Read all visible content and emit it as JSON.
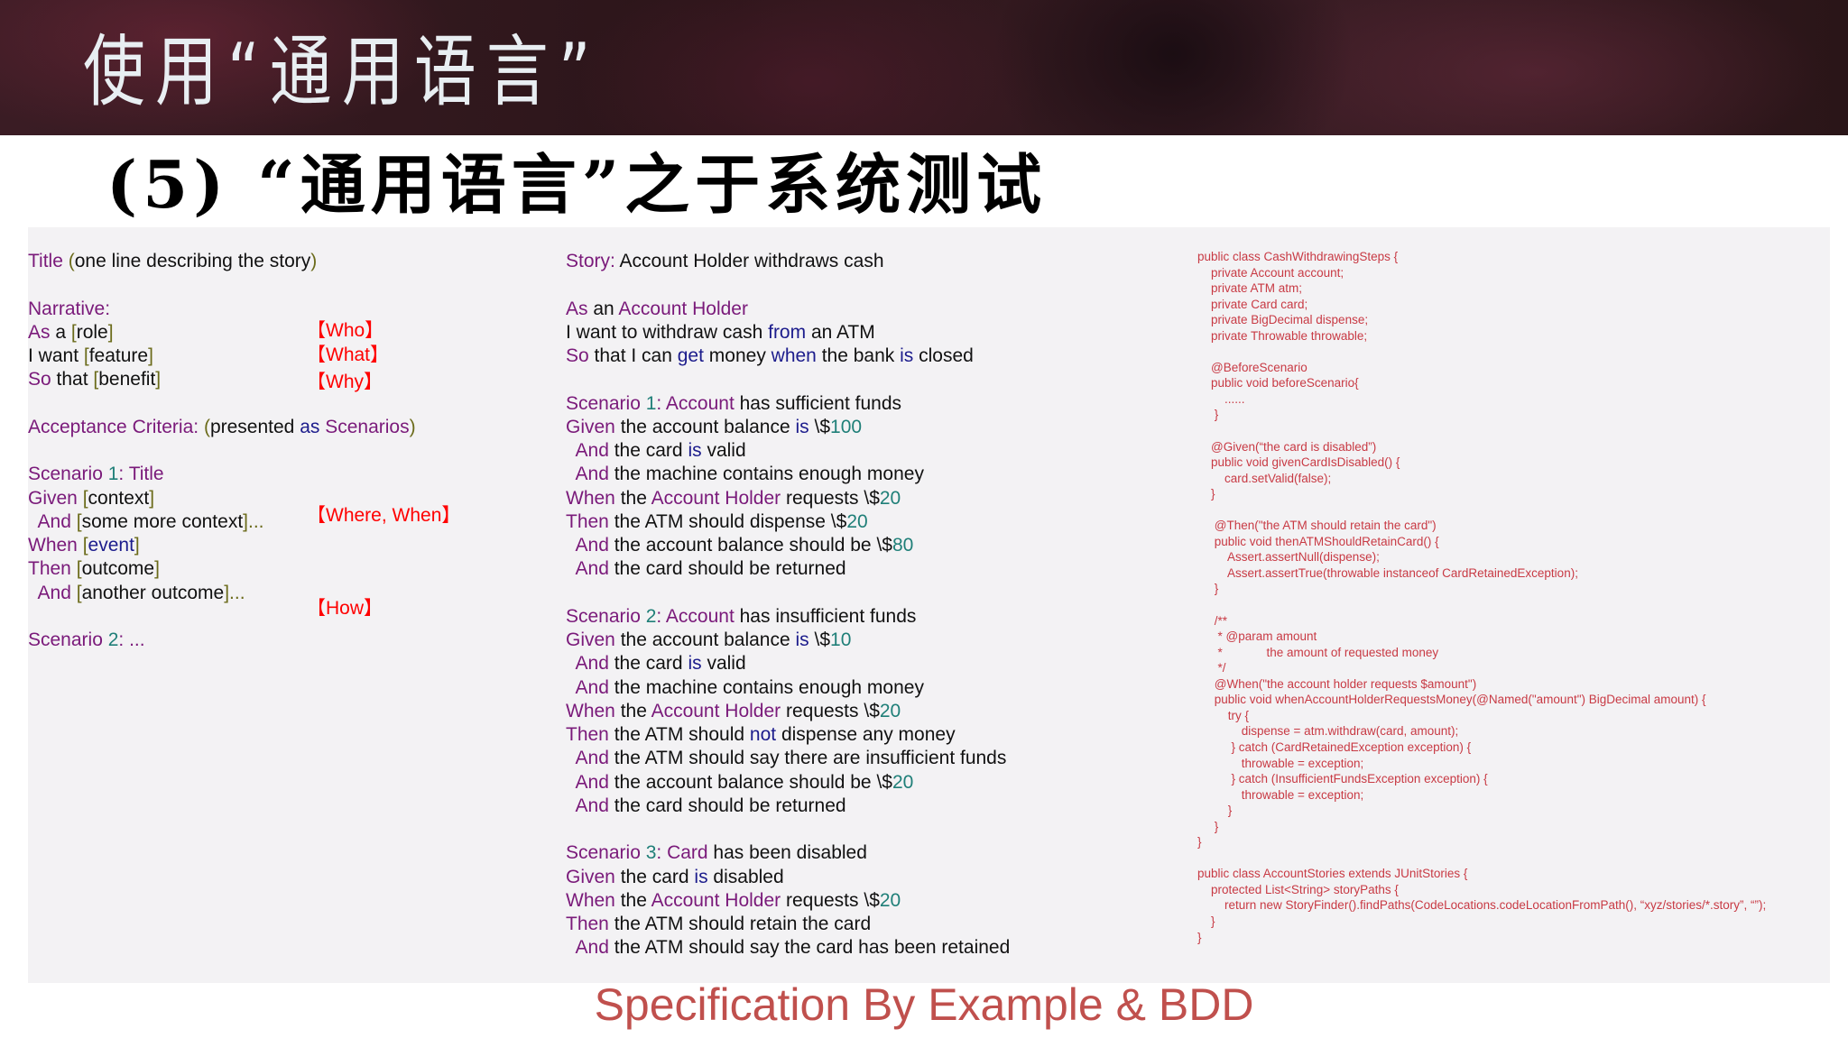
{
  "header": {
    "title": "使用“通用语言”"
  },
  "subtitle": "(5) “通用语言”之于系统测试",
  "colors": {
    "keyword": "#7a1a7a",
    "bracket": "#6b6b1a",
    "number": "#1f7f78",
    "verb": "#1c1c8c",
    "tag": "#ff0000",
    "code": "#c83a44",
    "footer": "#c0504d"
  },
  "template": [
    [
      [
        "Title",
        "k"
      ],
      [
        " ",
        ""
      ],
      [
        "(",
        "b"
      ],
      [
        "one line describing the story",
        ""
      ],
      [
        ")",
        "b"
      ]
    ],
    [],
    [
      [
        "Narrative:",
        "k"
      ]
    ],
    [
      [
        "As",
        "k"
      ],
      [
        " a ",
        ""
      ],
      [
        "[",
        "b"
      ],
      [
        "role",
        ""
      ],
      [
        "]",
        "b"
      ]
    ],
    [
      [
        "I want ",
        ""
      ],
      [
        "[",
        "b"
      ],
      [
        "feature",
        ""
      ],
      [
        "]",
        "b"
      ]
    ],
    [
      [
        "So",
        "k"
      ],
      [
        " that ",
        ""
      ],
      [
        "[",
        "b"
      ],
      [
        "benefit",
        ""
      ],
      [
        "]",
        "b"
      ]
    ],
    [],
    [
      [
        "Acceptance Criteria:",
        "k"
      ],
      [
        " ",
        ""
      ],
      [
        "(",
        "b"
      ],
      [
        "presented ",
        ""
      ],
      [
        "as",
        "v"
      ],
      [
        " Scenarios",
        "k"
      ],
      [
        ")",
        "b"
      ]
    ],
    [],
    [
      [
        "Scenario ",
        "k"
      ],
      [
        "1",
        "n"
      ],
      [
        ": Title",
        "k"
      ]
    ],
    [
      [
        "Given",
        "k"
      ],
      [
        " ",
        ""
      ],
      [
        "[",
        "b"
      ],
      [
        "context",
        ""
      ],
      [
        "]",
        "b"
      ]
    ],
    [
      [
        "  And",
        "k"
      ],
      [
        " ",
        ""
      ],
      [
        "[",
        "b"
      ],
      [
        "some more context",
        ""
      ],
      [
        "]...",
        "b"
      ]
    ],
    [
      [
        "When",
        "k"
      ],
      [
        " ",
        ""
      ],
      [
        "[",
        "b"
      ],
      [
        "event",
        "v"
      ],
      [
        "]",
        "b"
      ]
    ],
    [
      [
        "Then",
        "k"
      ],
      [
        " ",
        ""
      ],
      [
        "[",
        "b"
      ],
      [
        "outcome",
        ""
      ],
      [
        "]",
        "b"
      ]
    ],
    [
      [
        "  And",
        "k"
      ],
      [
        " ",
        ""
      ],
      [
        "[",
        "b"
      ],
      [
        "another outcome",
        ""
      ],
      [
        "]...",
        "b"
      ]
    ],
    [],
    [
      [
        "Scenario ",
        "k"
      ],
      [
        "2",
        "n"
      ],
      [
        ": ...",
        "k"
      ]
    ]
  ],
  "tags": [
    "【Who】",
    "【What】",
    "【Why】",
    "【Where, When】",
    "【How】"
  ],
  "story": [
    [
      [
        "Story:",
        "k"
      ],
      [
        " Account Holder withdraws cash",
        ""
      ]
    ],
    [],
    [
      [
        "As",
        "k"
      ],
      [
        " an ",
        ""
      ],
      [
        "Account Holder",
        "k"
      ]
    ],
    [
      [
        "I want to withdraw cash ",
        ""
      ],
      [
        "from",
        "v"
      ],
      [
        " an ATM",
        ""
      ]
    ],
    [
      [
        "So",
        "k"
      ],
      [
        " that I can ",
        ""
      ],
      [
        "get",
        "v"
      ],
      [
        " money ",
        ""
      ],
      [
        "when",
        "v"
      ],
      [
        " the bank ",
        ""
      ],
      [
        "is",
        "v"
      ],
      [
        " closed",
        ""
      ]
    ],
    [],
    [
      [
        "Scenario ",
        "k"
      ],
      [
        "1",
        "n"
      ],
      [
        ": Account",
        "k"
      ],
      [
        " has sufficient funds",
        ""
      ]
    ],
    [
      [
        "Given",
        "k"
      ],
      [
        " the account balance ",
        ""
      ],
      [
        "is",
        "v"
      ],
      [
        " \\$",
        ""
      ],
      [
        "100",
        "n"
      ]
    ],
    [
      [
        "  And",
        "k"
      ],
      [
        " the card ",
        ""
      ],
      [
        "is",
        "v"
      ],
      [
        " valid",
        ""
      ]
    ],
    [
      [
        "  And",
        "k"
      ],
      [
        " the machine contains enough money",
        ""
      ]
    ],
    [
      [
        "When",
        "k"
      ],
      [
        " the ",
        ""
      ],
      [
        "Account Holder",
        "k"
      ],
      [
        " requests \\$",
        ""
      ],
      [
        "20",
        "n"
      ]
    ],
    [
      [
        "Then",
        "k"
      ],
      [
        " the ATM should dispense \\$",
        ""
      ],
      [
        "20",
        "n"
      ]
    ],
    [
      [
        "  And",
        "k"
      ],
      [
        " the account balance should be \\$",
        ""
      ],
      [
        "80",
        "n"
      ]
    ],
    [
      [
        "  And",
        "k"
      ],
      [
        " the card should be returned",
        ""
      ]
    ],
    [],
    [
      [
        "Scenario ",
        "k"
      ],
      [
        "2",
        "n"
      ],
      [
        ": Account",
        "k"
      ],
      [
        " has insufficient funds",
        ""
      ]
    ],
    [
      [
        "Given",
        "k"
      ],
      [
        " the account balance ",
        ""
      ],
      [
        "is",
        "v"
      ],
      [
        " \\$",
        ""
      ],
      [
        "10",
        "n"
      ]
    ],
    [
      [
        "  And",
        "k"
      ],
      [
        " the card ",
        ""
      ],
      [
        "is",
        "v"
      ],
      [
        " valid",
        ""
      ]
    ],
    [
      [
        "  And",
        "k"
      ],
      [
        " the machine contains enough money",
        ""
      ]
    ],
    [
      [
        "When",
        "k"
      ],
      [
        " the ",
        ""
      ],
      [
        "Account Holder",
        "k"
      ],
      [
        " requests \\$",
        ""
      ],
      [
        "20",
        "n"
      ]
    ],
    [
      [
        "Then",
        "k"
      ],
      [
        " the ATM should ",
        ""
      ],
      [
        "not",
        "v"
      ],
      [
        " dispense any money",
        ""
      ]
    ],
    [
      [
        "  And",
        "k"
      ],
      [
        " the ATM should say there are insufficient funds",
        ""
      ]
    ],
    [
      [
        "  And",
        "k"
      ],
      [
        " the account balance should be \\$",
        ""
      ],
      [
        "20",
        "n"
      ]
    ],
    [
      [
        "  And",
        "k"
      ],
      [
        " the card should be returned",
        ""
      ]
    ],
    [],
    [
      [
        "Scenario ",
        "k"
      ],
      [
        "3",
        "n"
      ],
      [
        ": Card",
        "k"
      ],
      [
        " has been disabled",
        ""
      ]
    ],
    [
      [
        "Given",
        "k"
      ],
      [
        " the card ",
        ""
      ],
      [
        "is",
        "v"
      ],
      [
        " disabled",
        ""
      ]
    ],
    [
      [
        "When",
        "k"
      ],
      [
        " the ",
        ""
      ],
      [
        "Account Holder",
        "k"
      ],
      [
        " requests \\$",
        ""
      ],
      [
        "20",
        "n"
      ]
    ],
    [
      [
        "Then",
        "k"
      ],
      [
        " the ATM should retain the card",
        ""
      ]
    ],
    [
      [
        "  And",
        "k"
      ],
      [
        " the ATM should say the card has been retained",
        ""
      ]
    ]
  ],
  "code": [
    "public class CashWithdrawingSteps {",
    "    private Account account;",
    "    private ATM atm;",
    "    private Card card;",
    "    private BigDecimal dispense;",
    "    private Throwable throwable;",
    "",
    "    @BeforeScenario",
    "    public void beforeScenario{",
    "        ......",
    "     }",
    "",
    "    @Given(“the card is disabled”)",
    "    public void givenCardIsDisabled() {",
    "        card.setValid(false);",
    "    }",
    "",
    "     @Then(\"the ATM should retain the card\")",
    "     public void thenATMShouldRetainCard() {",
    "         Assert.assertNull(dispense);",
    "         Assert.assertTrue(throwable instanceof CardRetainedException);",
    "     }",
    "",
    "     /**",
    "      * @param amount",
    "      *             the amount of requested money",
    "      */",
    "     @When(\"the account holder requests $amount\")",
    "     public void whenAccountHolderRequestsMoney(@Named(\"amount\") BigDecimal amount) {",
    "         try {",
    "             dispense = atm.withdraw(card, amount);",
    "          } catch (CardRetainedException exception) {",
    "             throwable = exception;",
    "          } catch (InsufficientFundsException exception) {",
    "             throwable = exception;",
    "         }",
    "     }",
    "}",
    "",
    "public class AccountStories extends JUnitStories {",
    "    protected List<String> storyPaths {",
    "        return new StoryFinder().findPaths(CodeLocations.codeLocationFromPath(), “xyz/stories/*.story”, “”);",
    "    }",
    "}"
  ],
  "footer": "Specification By Example & BDD"
}
